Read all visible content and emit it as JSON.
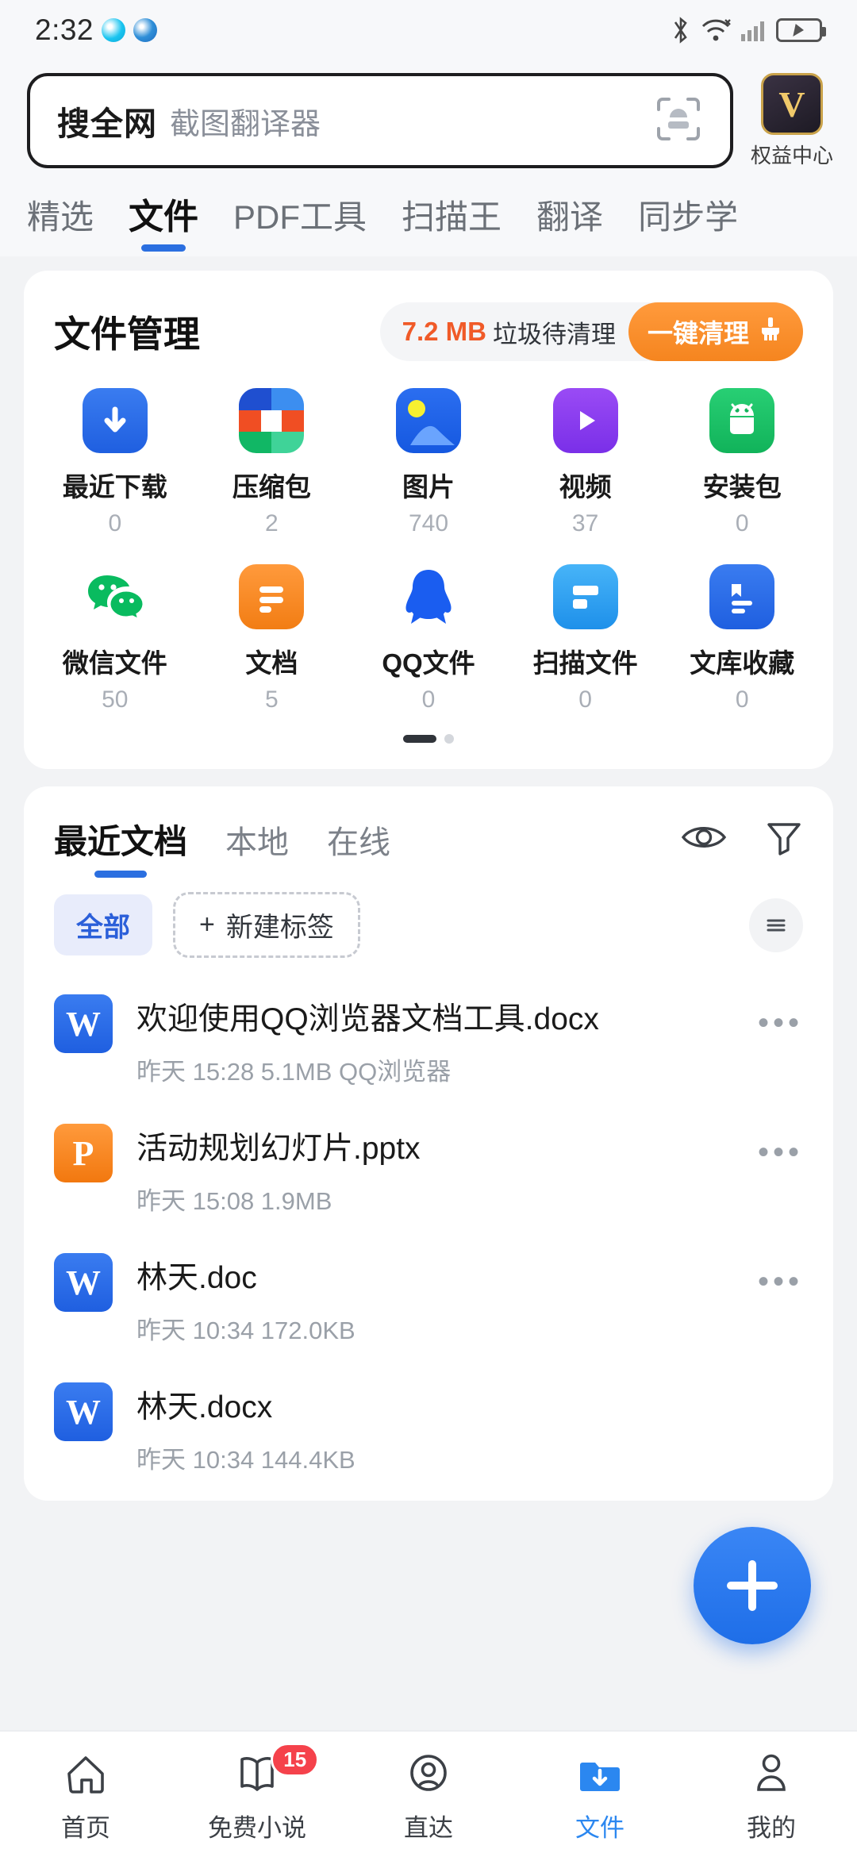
{
  "status_bar": {
    "time": "2:32",
    "icons": [
      "bluetooth-icon",
      "wifi-icon",
      "cellular-icon",
      "battery-charging-icon"
    ]
  },
  "search": {
    "scope_label": "搜全网",
    "placeholder": "截图翻译器",
    "scan_icon": "scan-icon"
  },
  "vip": {
    "badge_letter": "V",
    "label": "权益中心"
  },
  "top_tabs": [
    {
      "label": "精选",
      "active": false
    },
    {
      "label": "文件",
      "active": true
    },
    {
      "label": "PDF工具",
      "active": false
    },
    {
      "label": "扫描王",
      "active": false
    },
    {
      "label": "翻译",
      "active": false
    },
    {
      "label": "同步学",
      "active": false
    }
  ],
  "file_manage": {
    "title": "文件管理",
    "junk_size": "7.2 MB",
    "junk_text": "垃圾待清理",
    "clean_button": "一键清理",
    "clean_icon": "broom-icon",
    "categories": [
      {
        "name": "最近下载",
        "count": "0",
        "icon": "download-icon",
        "color": "#2b6fe0"
      },
      {
        "name": "压缩包",
        "count": "2",
        "icon": "archive-icon",
        "color": "#1f5fd8"
      },
      {
        "name": "图片",
        "count": "740",
        "icon": "image-icon",
        "color": "#1f6ae8"
      },
      {
        "name": "视频",
        "count": "37",
        "icon": "video-icon",
        "color": "#8b3ff0"
      },
      {
        "name": "安装包",
        "count": "0",
        "icon": "android-icon",
        "color": "#1fbd63"
      },
      {
        "name": "微信文件",
        "count": "50",
        "icon": "wechat-icon",
        "color": "#09bb5f"
      },
      {
        "name": "文档",
        "count": "5",
        "icon": "document-icon",
        "color": "#f5861f"
      },
      {
        "name": "QQ文件",
        "count": "0",
        "icon": "qq-penguin-icon",
        "color": "#1a5df0"
      },
      {
        "name": "扫描文件",
        "count": "0",
        "icon": "scanner-icon",
        "color": "#2b9ff5"
      },
      {
        "name": "文库收藏",
        "count": "0",
        "icon": "bookmark-doc-icon",
        "color": "#2b6fe0"
      }
    ]
  },
  "recent_docs": {
    "tabs": [
      {
        "label": "最近文档",
        "active": true
      },
      {
        "label": "本地",
        "active": false
      },
      {
        "label": "在线",
        "active": false
      }
    ],
    "actions": [
      "eye-icon",
      "filter-icon"
    ],
    "tag_all": "全部",
    "tag_new": "新建标签",
    "tag_new_icon": "plus-icon",
    "list_menu_icon": "list-menu-icon",
    "files": [
      {
        "name": "欢迎使用QQ浏览器文档工具.docx",
        "meta": "昨天 15:28  5.1MB  QQ浏览器",
        "type": "W",
        "color": "#2b6fe0",
        "more": "•••"
      },
      {
        "name": "活动规划幻灯片.pptx",
        "meta": "昨天 15:08  1.9MB",
        "type": "P",
        "color": "#f5861f",
        "more": "•••"
      },
      {
        "name": "林天.doc",
        "meta": "昨天 10:34  172.0KB",
        "type": "W",
        "color": "#2b6fe0",
        "more": "•••"
      },
      {
        "name": "林天.docx",
        "meta": "昨天 10:34  144.4KB",
        "type": "W",
        "color": "#2b6fe0",
        "more": "•••"
      }
    ]
  },
  "fab": {
    "icon": "plus-icon"
  },
  "bottom_nav": [
    {
      "label": "首页",
      "icon": "home-icon",
      "active": false,
      "badge": ""
    },
    {
      "label": "免费小说",
      "icon": "book-icon",
      "active": false,
      "badge": "15"
    },
    {
      "label": "直达",
      "icon": "direct-icon",
      "active": false,
      "badge": ""
    },
    {
      "label": "文件",
      "icon": "folder-download-icon",
      "active": true,
      "badge": ""
    },
    {
      "label": "我的",
      "icon": "person-icon",
      "active": false,
      "badge": ""
    }
  ],
  "colors": {
    "accent": "#2b6fe0",
    "orange": "#f5851f",
    "badge_red": "#f5424b"
  }
}
